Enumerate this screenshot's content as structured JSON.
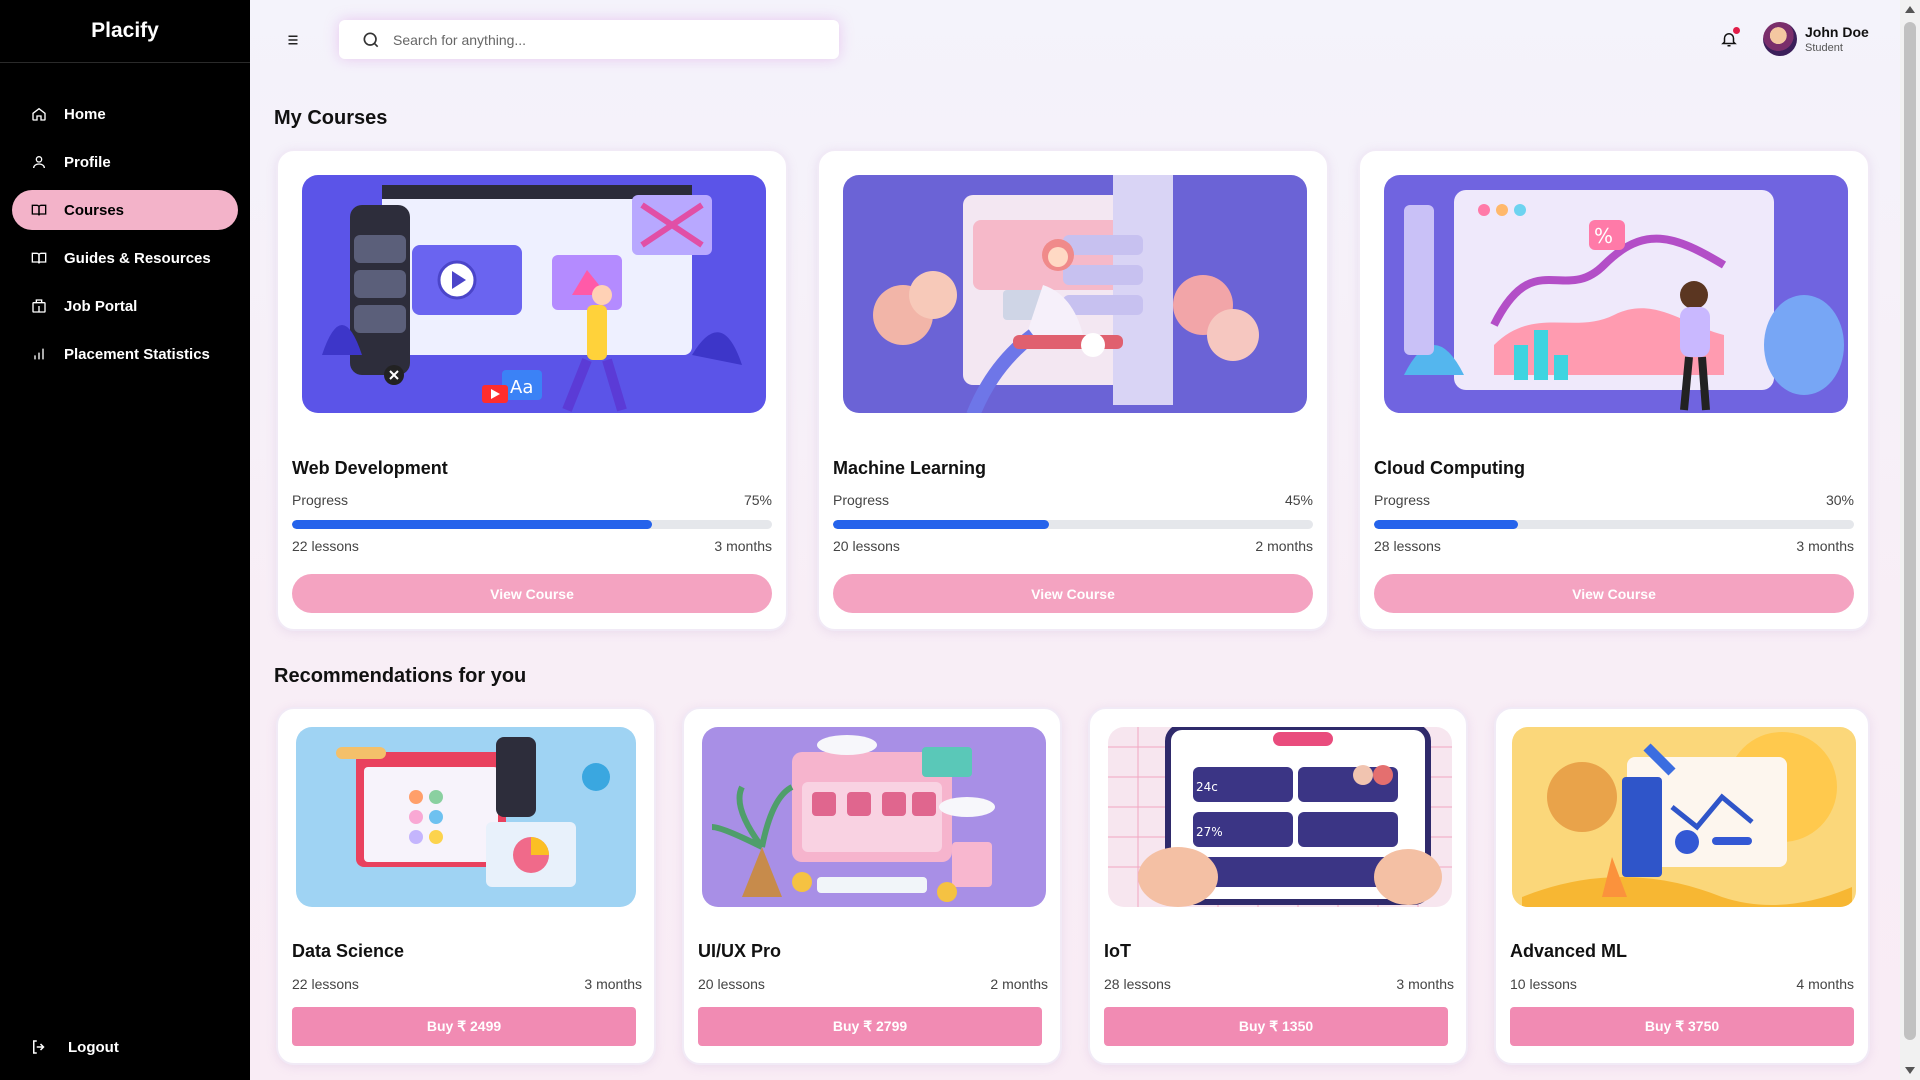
{
  "brand": "Placify",
  "nav": {
    "items": [
      {
        "label": "Home",
        "icon": "home-icon"
      },
      {
        "label": "Profile",
        "icon": "user-icon"
      },
      {
        "label": "Courses",
        "icon": "book-icon"
      },
      {
        "label": "Guides & Resources",
        "icon": "book-icon"
      },
      {
        "label": "Job Portal",
        "icon": "building-icon"
      },
      {
        "label": "Placement Statistics",
        "icon": "bar-chart-icon"
      }
    ],
    "active": "Courses",
    "logout": "Logout"
  },
  "header": {
    "search_placeholder": "Search for anything...",
    "notification_dot_color": "#e11d48",
    "user": {
      "name": "John Doe",
      "role": "Student"
    }
  },
  "my_courses": {
    "title": "My Courses",
    "progress_label": "Progress",
    "button_label": "View Course",
    "items": [
      {
        "title": "Web Development",
        "progress": "75%",
        "progress_value": 0.75,
        "lessons": "22 lessons",
        "duration": "3 months"
      },
      {
        "title": "Machine Learning",
        "progress": "45%",
        "progress_value": 0.45,
        "lessons": "20 lessons",
        "duration": "2 months"
      },
      {
        "title": "Cloud Computing",
        "progress": "30%",
        "progress_value": 0.3,
        "lessons": "28 lessons",
        "duration": "3 months"
      }
    ]
  },
  "recommendations": {
    "title": "Recommendations for you",
    "items": [
      {
        "title": "Data Science",
        "lessons": "22 lessons",
        "duration": "3 months",
        "price_label": "Buy ₹ 2499"
      },
      {
        "title": "UI/UX Pro",
        "lessons": "20 lessons",
        "duration": "2 months",
        "price_label": "Buy ₹ 2799"
      },
      {
        "title": "IoT",
        "lessons": "28 lessons",
        "duration": "3 months",
        "price_label": "Buy ₹ 1350"
      },
      {
        "title": "Advanced ML",
        "lessons": "10 lessons",
        "duration": "4 months",
        "price_label": "Buy ₹ 3750"
      }
    ]
  },
  "colors": {
    "accent_pink": "#f4a3c1",
    "progress_blue": "#2563eb",
    "sidebar_bg": "#000000"
  }
}
